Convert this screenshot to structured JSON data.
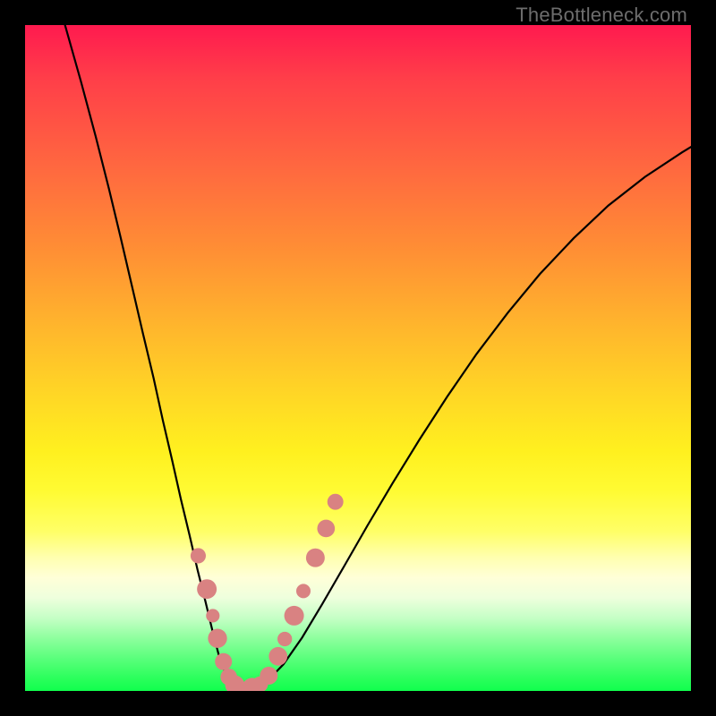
{
  "watermark": {
    "text": "TheBottleneck.com"
  },
  "chart_data": {
    "type": "line",
    "title": "",
    "xlabel": "",
    "ylabel": "",
    "xlim": [
      0,
      100
    ],
    "ylim": [
      0,
      100
    ],
    "grid": false,
    "background": "red-yellow-green vertical heat gradient",
    "series": [
      {
        "name": "left-branch",
        "color": "#000000",
        "x": [
          6.0,
          8.4,
          10.6,
          12.6,
          14.4,
          16.1,
          17.7,
          19.3,
          20.7,
          22.1,
          23.4,
          24.7,
          25.9,
          27.1,
          28.2,
          29.3,
          30.4,
          31.4,
          32.3,
          33.0
        ],
        "y": [
          100.0,
          91.5,
          83.3,
          75.4,
          67.9,
          60.6,
          53.7,
          47.0,
          40.6,
          34.6,
          28.8,
          23.4,
          18.2,
          13.4,
          8.8,
          4.6,
          2.0,
          0.6,
          0.1,
          0.0
        ]
      },
      {
        "name": "right-branch",
        "color": "#000000",
        "x": [
          33.0,
          34.4,
          36.4,
          38.8,
          41.6,
          44.6,
          47.9,
          51.4,
          55.2,
          59.2,
          63.4,
          67.8,
          72.5,
          77.3,
          82.4,
          87.6,
          93.1,
          98.7,
          100.0
        ],
        "y": [
          0.0,
          0.3,
          1.5,
          4.0,
          8.0,
          13.0,
          18.7,
          24.8,
          31.2,
          37.7,
          44.2,
          50.6,
          56.8,
          62.6,
          68.0,
          72.9,
          77.2,
          80.9,
          81.7
        ]
      }
    ],
    "marker_overlay": {
      "name": "pink-beads",
      "shape": "circle",
      "color": "#d98282",
      "radius_px_range": [
        7,
        11
      ],
      "points": [
        {
          "x": 26.0,
          "y": 20.3
        },
        {
          "x": 27.3,
          "y": 15.3
        },
        {
          "x": 28.2,
          "y": 11.3
        },
        {
          "x": 28.9,
          "y": 7.9
        },
        {
          "x": 29.8,
          "y": 4.4
        },
        {
          "x": 30.6,
          "y": 2.1
        },
        {
          "x": 31.5,
          "y": 0.9
        },
        {
          "x": 32.8,
          "y": 0.4
        },
        {
          "x": 34.1,
          "y": 0.5
        },
        {
          "x": 35.3,
          "y": 1.0
        },
        {
          "x": 36.6,
          "y": 2.3
        },
        {
          "x": 38.0,
          "y": 5.2
        },
        {
          "x": 39.0,
          "y": 7.8
        },
        {
          "x": 40.4,
          "y": 11.3
        },
        {
          "x": 41.8,
          "y": 15.0
        },
        {
          "x": 43.6,
          "y": 20.0
        },
        {
          "x": 45.2,
          "y": 24.4
        },
        {
          "x": 46.6,
          "y": 28.4
        }
      ]
    }
  }
}
